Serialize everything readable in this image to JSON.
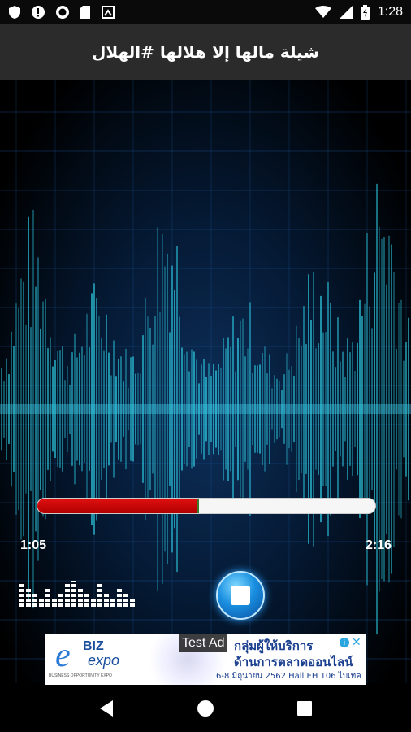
{
  "status_bar": {
    "time": "1:28",
    "icons_left": [
      "shield-icon",
      "alert-icon",
      "record-icon",
      "sd-card-icon",
      "cast-icon"
    ],
    "icons_right": [
      "wifi-icon",
      "signal-icon",
      "battery-icon"
    ]
  },
  "app_bar": {
    "title": "شيلة مالها إلا هلالها #الهلال"
  },
  "player": {
    "elapsed": "1:05",
    "total": "2:16",
    "progress_fraction": 0.478,
    "progress_color": "#d40000",
    "track_color": "#f6f6f6",
    "equalizer_icon": "equalizer-icon",
    "stop_icon": "stop-icon"
  },
  "ad": {
    "label": "Test Ad",
    "logo_e": "e",
    "logo_biz": "BIZ",
    "logo_expo": "expo",
    "headline": "กลุ่มผู้ให้บริการ",
    "subline": "ด้านการตลาดออนไลน์",
    "date_line": "6-8 มิถุนายน 2562  Hall EH 106 ไบเทค",
    "caption": "BUSINESS OPPORTUNITY EXPO",
    "info_icon": "info-icon",
    "close_icon": "close-icon",
    "info_glyph": "i",
    "close_glyph": "✕"
  },
  "nav_bar": {
    "items": [
      "back-icon",
      "home-icon",
      "recents-icon"
    ]
  },
  "colors": {
    "app_bar_bg": "#2b2b2b",
    "wave_color": "#2fd0e6",
    "background_deep": "#051a35"
  }
}
